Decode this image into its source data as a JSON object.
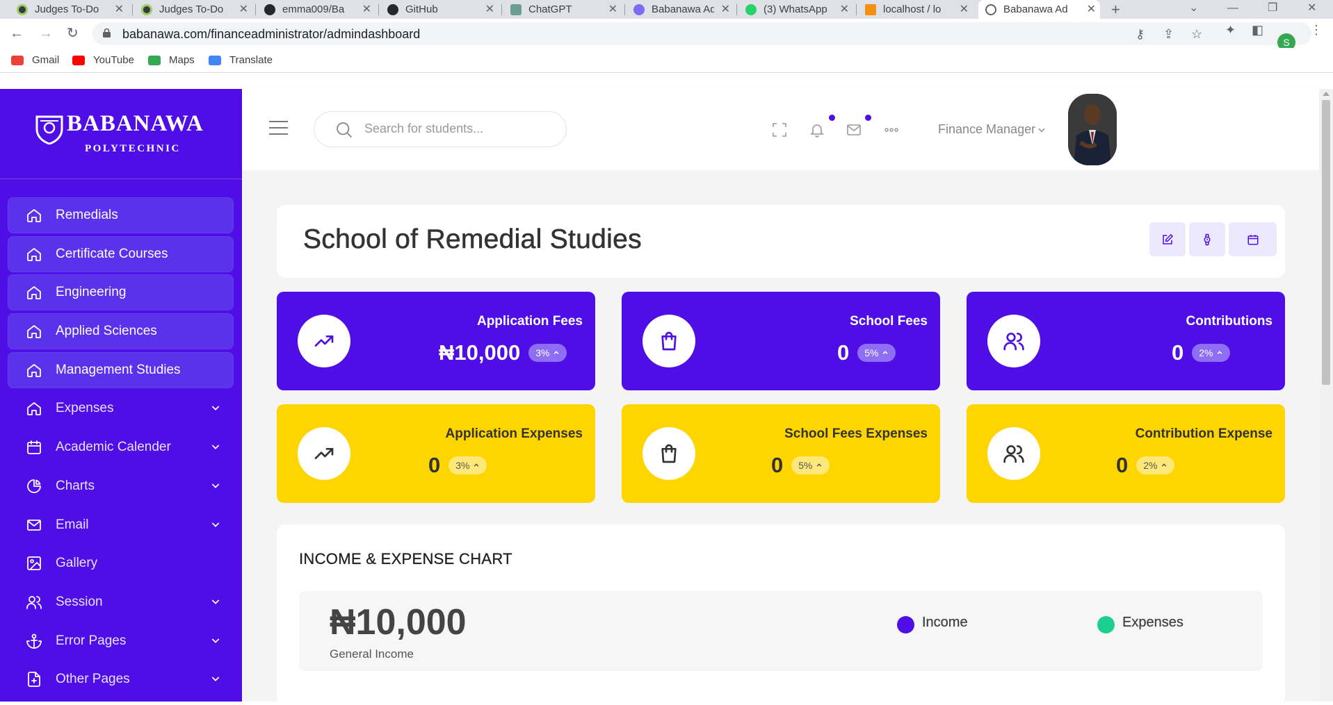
{
  "browser": {
    "tabs": [
      {
        "title": "Judges To-Do",
        "favicon_color": "#3a3a3a"
      },
      {
        "title": "Judges To-Do",
        "favicon_color": "#3a3a3a"
      },
      {
        "title": "emma009/Ba",
        "favicon_color": "#24292f"
      },
      {
        "title": "GitHub",
        "favicon_color": "#24292f"
      },
      {
        "title": "ChatGPT",
        "favicon_color": "#6b9e8f"
      },
      {
        "title": "Babanawa Ad",
        "favicon_color": "#7d6df2"
      },
      {
        "title": "(3) WhatsApp",
        "favicon_color": "#25d366"
      },
      {
        "title": "localhost / lo",
        "favicon_color": "#f29111"
      },
      {
        "title": "Babanawa Ad",
        "favicon_color": "#5f6368"
      }
    ],
    "url": "babanawa.com/financeadministrator/admindashboard",
    "profile_initial": "S",
    "bookmarks": [
      {
        "label": "Gmail",
        "color": "#ea4335"
      },
      {
        "label": "YouTube",
        "color": "#ff0000"
      },
      {
        "label": "Maps",
        "color": "#34a853"
      },
      {
        "label": "Translate",
        "color": "#4285f4"
      }
    ]
  },
  "sidebar": {
    "logo_name": "BABANAWA",
    "logo_sub": "POLYTECHNIC",
    "items": [
      {
        "label": "Remedials",
        "icon": "home-icon",
        "highlight": true,
        "chevron": false
      },
      {
        "label": "Certificate Courses",
        "icon": "home-icon",
        "highlight": true,
        "chevron": false
      },
      {
        "label": "Engineering",
        "icon": "home-icon",
        "highlight": true,
        "chevron": false
      },
      {
        "label": "Applied Sciences",
        "icon": "home-icon",
        "highlight": true,
        "chevron": false
      },
      {
        "label": "Management Studies",
        "icon": "home-icon",
        "highlight": true,
        "chevron": false
      },
      {
        "label": "Expenses",
        "icon": "home-icon",
        "highlight": false,
        "chevron": true
      },
      {
        "label": "Academic Calender",
        "icon": "calendar-icon",
        "highlight": false,
        "chevron": true
      },
      {
        "label": "Charts",
        "icon": "pie-chart-icon",
        "highlight": false,
        "chevron": true
      },
      {
        "label": "Email",
        "icon": "mail-icon",
        "highlight": false,
        "chevron": true
      },
      {
        "label": "Gallery",
        "icon": "image-icon",
        "highlight": false,
        "chevron": false
      },
      {
        "label": "Session",
        "icon": "users-icon",
        "highlight": false,
        "chevron": true
      },
      {
        "label": "Error Pages",
        "icon": "anchor-icon",
        "highlight": false,
        "chevron": true
      },
      {
        "label": "Other Pages",
        "icon": "file-plus-icon",
        "highlight": false,
        "chevron": true
      }
    ]
  },
  "topbar": {
    "search_placeholder": "Search for students...",
    "role": "Finance Manager"
  },
  "page": {
    "title": "School of Remedial Studies",
    "header_buttons": [
      "edit-icon",
      "watch-icon",
      "calendar-icon"
    ]
  },
  "stats": [
    {
      "label": "Application Fees",
      "value": "₦10,000",
      "badge": "3%",
      "icon": "trending-up-icon",
      "theme": "purple"
    },
    {
      "label": "School Fees",
      "value": "0",
      "badge": "5%",
      "icon": "shopping-bag-icon",
      "theme": "purple"
    },
    {
      "label": "Contributions",
      "value": "0",
      "badge": "2%",
      "icon": "users-icon",
      "theme": "purple"
    },
    {
      "label": "Application Expenses",
      "value": "0",
      "badge": "3%",
      "icon": "trending-up-icon",
      "theme": "yellow"
    },
    {
      "label": "School Fees Expenses",
      "value": "0",
      "badge": "5%",
      "icon": "shopping-bag-icon",
      "theme": "yellow"
    },
    {
      "label": "Contribution Expense",
      "value": "0",
      "badge": "2%",
      "icon": "users-icon",
      "theme": "yellow"
    }
  ],
  "chart": {
    "title": "INCOME & EXPENSE CHART",
    "total": "₦10,000",
    "total_label": "General Income",
    "legend": [
      {
        "label": "Income",
        "color": "#4f0ee6"
      },
      {
        "label": "Expenses",
        "color": "#1ccf8f"
      }
    ]
  },
  "colors": {
    "brand": "#4f0ee6",
    "accent_yellow": "#ffd500"
  }
}
